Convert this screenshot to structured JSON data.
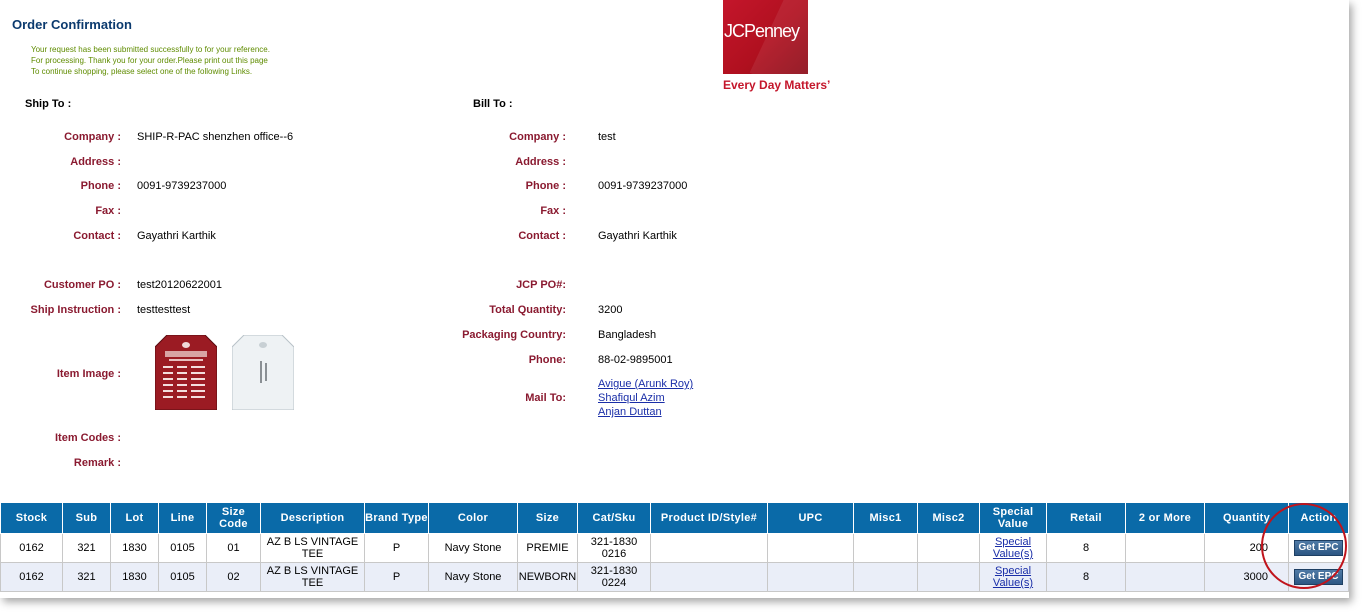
{
  "page_title": "Order Confirmation",
  "messages": [
    "Your request has been submitted successfully to for your reference.",
    "For processing. Thank you for your order.Please print out this page",
    "To continue shopping, please select one of the following Links."
  ],
  "logo": {
    "text": "JCPenney",
    "slogan": "Every Day Matters’"
  },
  "ship_to": {
    "heading": "Ship To :",
    "company_label": "Company :",
    "company": "SHIP-R-PAC shenzhen office--6",
    "address_label": "Address :",
    "address": "",
    "phone_label": "Phone :",
    "phone": "0091-9739237000",
    "fax_label": "Fax :",
    "fax": "",
    "contact_label": "Contact :",
    "contact": "Gayathri Karthik"
  },
  "bill_to": {
    "heading": "Bill To :",
    "company_label": "Company :",
    "company": "test",
    "address_label": "Address :",
    "address": "",
    "phone_label": "Phone :",
    "phone": "0091-9739237000",
    "fax_label": "Fax :",
    "fax": "",
    "contact_label": "Contact :",
    "contact": "Gayathri Karthik"
  },
  "order": {
    "customer_po_label": "Customer PO :",
    "customer_po": "test20120622001",
    "ship_instruction_label": "Ship Instruction :",
    "ship_instruction": "testtesttest",
    "item_image_label": "Item Image :",
    "item_codes_label": "Item Codes :",
    "item_codes": "",
    "remark_label": "Remark :",
    "remark": "",
    "jcp_po_label": "JCP PO#:",
    "jcp_po": "",
    "total_quantity_label": "Total Quantity:",
    "total_quantity": "3200",
    "packaging_country_label": "Packaging Country:",
    "packaging_country": "Bangladesh",
    "phone_label": "Phone:",
    "phone": "88-02-9895001",
    "mail_to_label": "Mail To:",
    "mail_to": [
      "Avigue (Arunk Roy)",
      "Shafiqul Azim",
      "Anjan Duttan"
    ]
  },
  "table": {
    "headers": [
      "Stock",
      "Sub",
      "Lot",
      "Line",
      "Size Code",
      "Description",
      "Brand Type",
      "Color",
      "Size",
      "Cat/Sku",
      "Product ID/Style#",
      "UPC",
      "Misc1",
      "Misc2",
      "Special Value",
      "Retail",
      "2 or More",
      "Quantity",
      "Action"
    ],
    "rows": [
      {
        "stock": "0162",
        "sub": "321",
        "lot": "1830",
        "line": "0105",
        "size_code": "01",
        "description": "AZ B LS VINTAGE TEE",
        "brand_type": "P",
        "color": "Navy Stone",
        "size": "PREMIE",
        "cat_sku": "321-1830 0216",
        "product_id": "",
        "upc": "",
        "misc1": "",
        "misc2": "",
        "special_value": "Special Value(s)",
        "retail": "8",
        "two_or_more": "",
        "quantity": "200",
        "action": "Get EPC"
      },
      {
        "stock": "0162",
        "sub": "321",
        "lot": "1830",
        "line": "0105",
        "size_code": "02",
        "description": "AZ B LS VINTAGE TEE",
        "brand_type": "P",
        "color": "Navy Stone",
        "size": "NEWBORN",
        "cat_sku": "321-1830 0224",
        "product_id": "",
        "upc": "",
        "misc1": "",
        "misc2": "",
        "special_value": "Special Value(s)",
        "retail": "8",
        "two_or_more": "",
        "quantity": "3000",
        "action": "Get EPC"
      }
    ]
  },
  "colors": {
    "header_blue": "#0a6aa8",
    "label_maroon": "#8a1a30",
    "brand_red": "#c4162b",
    "message_green": "#5f8c00",
    "highlight_circle": "#c0141c"
  }
}
